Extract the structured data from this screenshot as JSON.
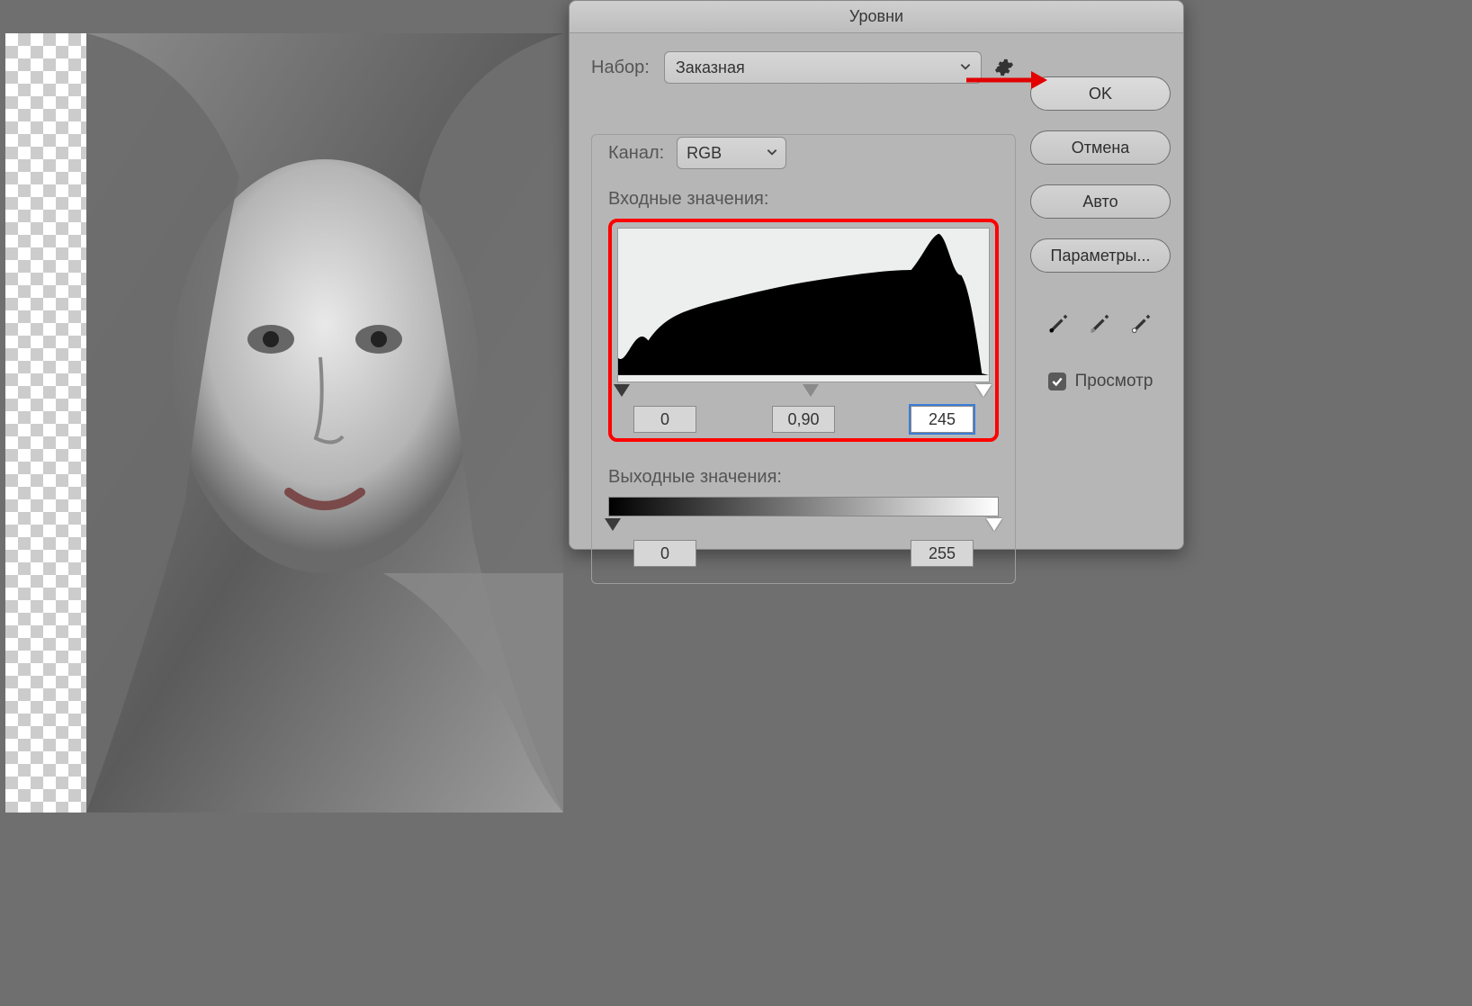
{
  "dialog": {
    "title": "Уровни",
    "preset_label": "Набор:",
    "preset_value": "Заказная",
    "channel_label": "Канал:",
    "channel_value": "RGB",
    "input_levels_label": "Входные значения:",
    "output_levels_label": "Выходные значения:",
    "input_black": "0",
    "input_gamma": "0,90",
    "input_white": "245",
    "output_black": "0",
    "output_white": "255"
  },
  "buttons": {
    "ok": "OK",
    "cancel": "Отмена",
    "auto": "Авто",
    "options": "Параметры..."
  },
  "preview": {
    "label": "Просмотр",
    "checked": true
  }
}
